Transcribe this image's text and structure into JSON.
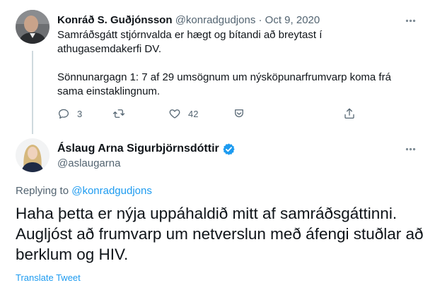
{
  "parent_tweet": {
    "name": "Konráð S. Guðjónsson",
    "handle": "@konradgudjons",
    "separator": "·",
    "date": "Oct 9, 2020",
    "body_line1": "Samráðsgátt stjórnvalda er hægt og bítandi að breytast í athugasemdakerfi DV.",
    "body_line2": "Sönnunargagn 1: 7 af 29 umsögnum um nýsköpunarfrumvarp koma frá sama einstaklingnum.",
    "actions": {
      "reply_icon": "reply-icon",
      "reply_count": "3",
      "retweet_icon": "retweet-icon",
      "retweet_count": "",
      "like_icon": "heart-icon",
      "like_count": "42",
      "bookmark_icon": "bookmark-icon",
      "share_icon": "share-icon"
    }
  },
  "main_tweet": {
    "name": "Áslaug Arna Sigurbjörnsdóttir",
    "verified_icon": "verified-badge-icon",
    "handle": "@aslaugarna",
    "replying_prefix": "Replying to",
    "replying_handle": "@konradgudjons",
    "text": "Haha þetta er nýja uppáhaldið mitt af samráðsgáttinni. Augljóst að frumvarp um netverslun með áfengi stuðlar að berklum og HIV.",
    "translate_label": "Translate Tweet"
  },
  "colors": {
    "accent": "#1d9bf0",
    "muted": "#536471",
    "text": "#0f1419",
    "thread_line": "#cfd9de"
  }
}
